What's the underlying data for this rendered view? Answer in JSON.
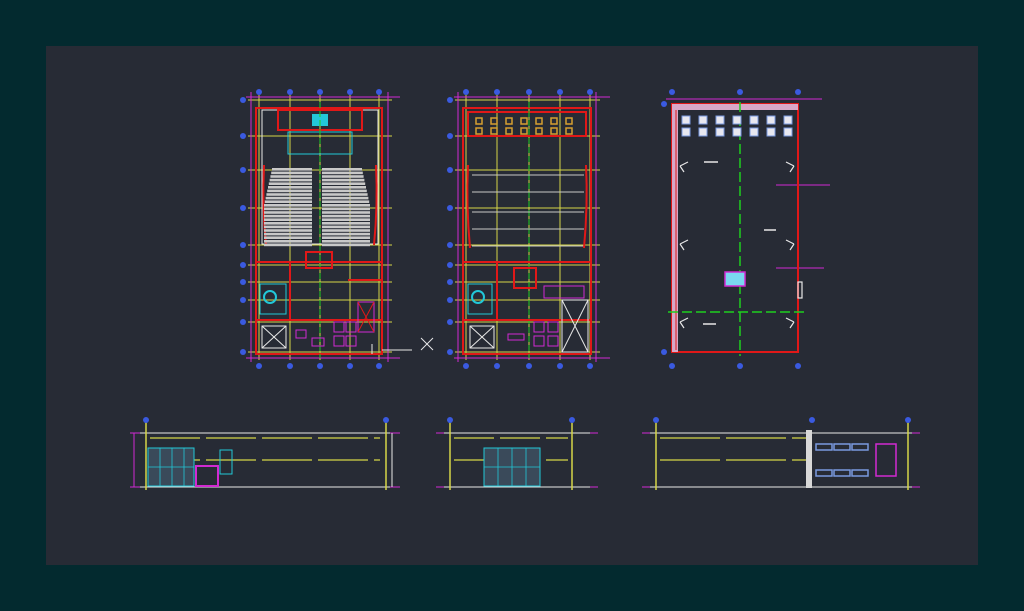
{
  "colors": {
    "background_outer": "#032a2f",
    "background_canvas": "#272b35",
    "wall_red": "#e01818",
    "grid_yellow": "#d6d648",
    "axis_green": "#1ed01e",
    "dim_magenta": "#d22ad2",
    "seat_white": "#c8c8c8",
    "line_white": "#e8e8e8",
    "cyan": "#22c8d8",
    "marker_blue": "#3a5ae0"
  },
  "drawings": [
    {
      "name": "plan-ground-floor",
      "kind": "floor plan with auditorium seating"
    },
    {
      "name": "plan-upper-floor",
      "kind": "floor plan"
    },
    {
      "name": "plan-roof",
      "kind": "roof plan"
    },
    {
      "name": "elevation-1",
      "kind": "elevation"
    },
    {
      "name": "elevation-2",
      "kind": "elevation"
    },
    {
      "name": "elevation-3",
      "kind": "elevation"
    }
  ],
  "icons": {
    "crosshair": "cad-crosshair-icon",
    "grid_marker": "grid-axis-marker-icon"
  }
}
